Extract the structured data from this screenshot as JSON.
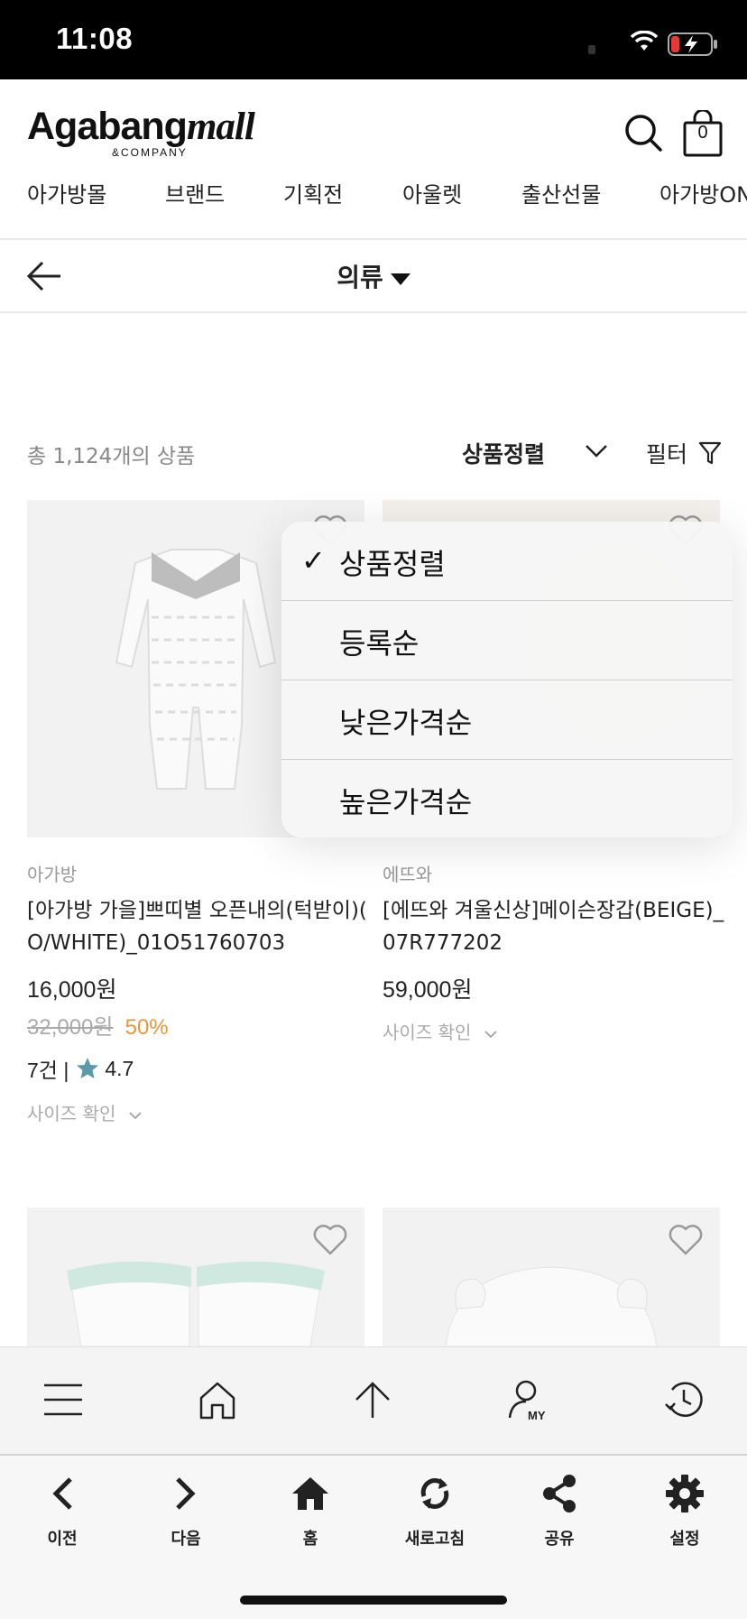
{
  "status_bar": {
    "time": "11:08"
  },
  "header": {
    "logo_main": "Agabang",
    "logo_mall": "mall",
    "logo_sub": "&COMPANY",
    "cart_count": "0",
    "nav_items": [
      "아가방몰",
      "브랜드",
      "기획전",
      "아울렛",
      "출산선물",
      "아가방ON"
    ]
  },
  "category": {
    "title": "의류"
  },
  "listing": {
    "count_text": "총 1,124개의 상품",
    "sort_label": "상품정렬",
    "filter_label": "필터"
  },
  "products": [
    {
      "brand": "아가방",
      "name_line1": "[아가방 가을]쁘띠별 오픈내의(턱받이)(",
      "name_line2": "O/WHITE)_01O51760703",
      "price": "16,000원",
      "original_price": "32,000원",
      "discount": "50%",
      "review_count": "7건 |",
      "rating": "4.7",
      "size_check": "사이즈 확인"
    },
    {
      "brand": "에뜨와",
      "name_line1": "[에뜨와 겨울신상]메이슨장갑(BEIGE)_",
      "name_line2": "07R777202",
      "price": "59,000원",
      "size_check": "사이즈 확인"
    }
  ],
  "sort_menu": {
    "items": [
      {
        "label": "상품정렬",
        "checked": true
      },
      {
        "label": "등록순",
        "checked": false
      },
      {
        "label": "낮은가격순",
        "checked": false
      },
      {
        "label": "높은가격순",
        "checked": false
      }
    ],
    "check_glyph": "✓"
  },
  "app_bar": {
    "icons": [
      "menu-icon",
      "home-outline-icon",
      "arrow-up-icon",
      "my-page-icon",
      "history-icon"
    ]
  },
  "toolbar": {
    "items": [
      {
        "label": "이전",
        "icon": "chevron-left-icon"
      },
      {
        "label": "다음",
        "icon": "chevron-right-icon"
      },
      {
        "label": "홈",
        "icon": "home-icon"
      },
      {
        "label": "새로고침",
        "icon": "refresh-icon"
      },
      {
        "label": "공유",
        "icon": "share-icon"
      },
      {
        "label": "설정",
        "icon": "gear-icon"
      }
    ]
  },
  "colors": {
    "discount": "#e8963a",
    "star": "#5b9aa8",
    "battery_low": "#e53935"
  }
}
